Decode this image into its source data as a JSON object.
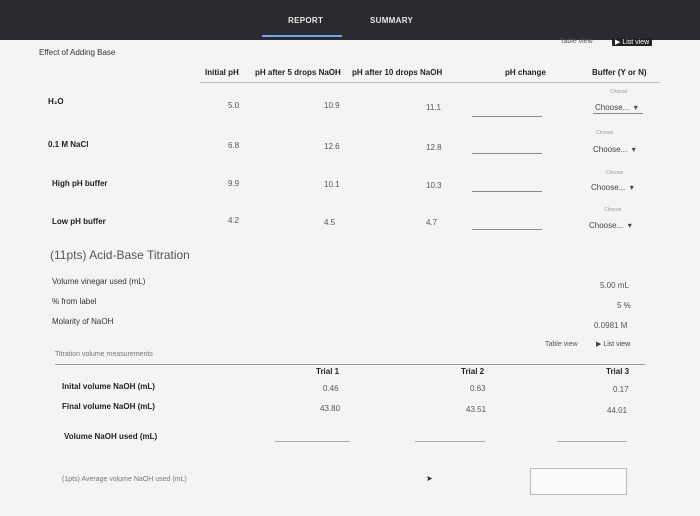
{
  "tabs": {
    "report": "REPORT",
    "summary": "SUMMARY"
  },
  "base_section": {
    "title": "Effect of Adding Base",
    "view_toggle": {
      "table": "Table view",
      "list": "List view"
    },
    "columns": {
      "initial_ph": "Initial pH",
      "ph_5_drops": "pH after 5 drops NaOH",
      "ph_10_drops": "pH after 10 drops NaOH",
      "ph_change": "pH change",
      "buffer": "Buffer (Y or N)"
    },
    "rows": [
      {
        "label": "H₂O",
        "initial": "5.0",
        "five": "10.9",
        "ten": "11.1",
        "hint": "Choose",
        "selected": "Choose..."
      },
      {
        "label": "0.1 M NaCl",
        "initial": "6.8",
        "five": "12.6",
        "ten": "12.8",
        "hint": "Choose",
        "selected": "Choose..."
      },
      {
        "label": "High pH buffer",
        "initial": "9.9",
        "five": "10.1",
        "ten": "10.3",
        "hint": "Choose",
        "selected": "Choose..."
      },
      {
        "label": "Low pH buffer",
        "initial": "4.2",
        "five": "4.5",
        "ten": "4.7",
        "hint": "Choose",
        "selected": "Choose..."
      }
    ]
  },
  "titration": {
    "title": "(11pts) Acid-Base Titration",
    "fields": [
      {
        "label": "Volume vinegar used (mL)",
        "value": "5.00 mL"
      },
      {
        "label": "% from label",
        "value": "5 %"
      },
      {
        "label": "Molarity of NaOH",
        "value": "0.0981 M"
      }
    ],
    "view_toggle": {
      "table": "Table view",
      "list": "List view"
    },
    "measurements_title": "Titration volume measurements",
    "trials": [
      "Trial 1",
      "Trial 2",
      "Trial 3"
    ],
    "rows": [
      {
        "label": "Inital volume NaOH (mL)",
        "values": [
          "0.46",
          "0.63",
          "0.17"
        ]
      },
      {
        "label": "Final volume NaOH (mL)",
        "values": [
          "43.80",
          "43.51",
          "44.01"
        ]
      }
    ],
    "used_label": "Volume NaOH used (mL)",
    "average_label": "(1pts)  Average volume NaOH used (mL)"
  }
}
